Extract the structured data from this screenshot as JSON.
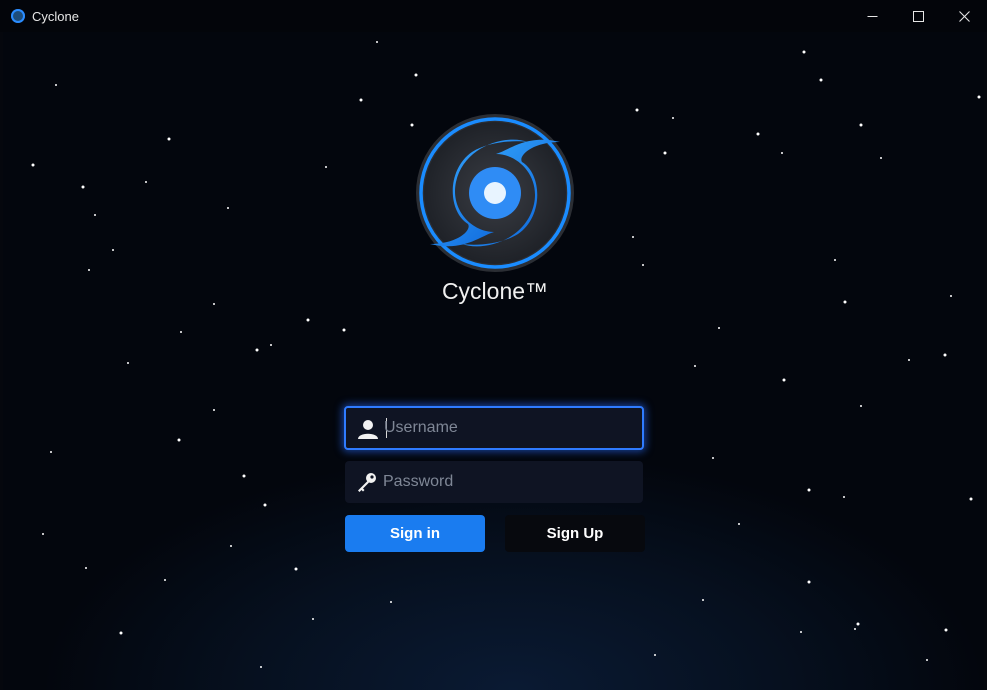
{
  "window": {
    "title": "Cyclone",
    "controls": {
      "minimize": "─",
      "maximize": "☐",
      "close": "✕"
    }
  },
  "app": {
    "name": "Cyclone™",
    "logo_icon": "cyclone-icon",
    "accent_color": "#1a7cf0"
  },
  "login": {
    "username": {
      "icon": "user-icon",
      "placeholder": "Username",
      "value": ""
    },
    "password": {
      "icon": "key-icon",
      "placeholder": "Password",
      "value": ""
    },
    "signin_label": "Sign in",
    "signup_label": "Sign Up"
  }
}
